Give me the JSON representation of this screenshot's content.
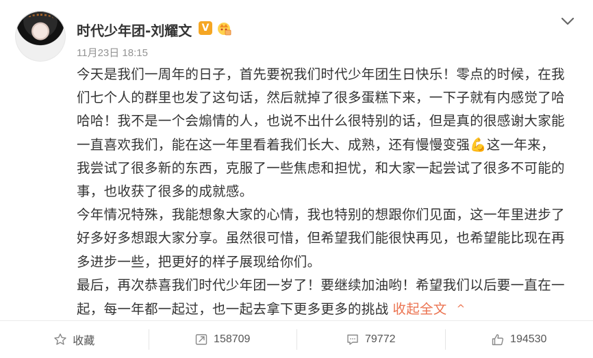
{
  "post": {
    "username": "时代少年团-刘耀文",
    "verified_badge": "V",
    "timestamp": "11月23日 18:15",
    "paragraphs": [
      "今天是我们一周年的日子，首先要祝我们时代少年团生日快乐！零点的时候，在我们七个人的群里也发了这句话，然后就掉了很多蛋糕下来，一下子就有内感觉了哈哈哈！我不是一个会煽情的人，也说不出什么很特别的话，但是真的很感谢大家能一直喜欢我们，能在这一年里看着我们长大、成熟，还有慢慢变强💪这一年来，我尝试了很多新的东西，克服了一些焦虑和担忧，和大家一起尝试了很多不可能的事，也收获了很多的成就感。",
      "今年情况特殊，我能想象大家的心情，我也特别的想跟你们见面，这一年里进步了好多好多想跟大家分享。虽然很可惜，但希望我们能很快再见，也希望能比现在再多进步一些，把更好的样子展现给你们。",
      "最后，再次恭喜我们时代少年团一岁了！要继续加油哟！希望我们以后要一直在一起，每一年都一起过，也一起去拿下更多更多的挑战"
    ],
    "collapse_label": "收起全文",
    "collapse_arrow": "^"
  },
  "actions": {
    "favorite": {
      "label": "收藏",
      "icon": "star-icon"
    },
    "repost": {
      "count": "158709",
      "icon": "repost-icon"
    },
    "comment": {
      "count": "79772",
      "icon": "comment-icon"
    },
    "like": {
      "count": "194530",
      "icon": "thumbs-up-icon"
    }
  },
  "colors": {
    "accent": "#eb7350",
    "badge": "#f5a623",
    "text": "#333333",
    "meta": "#939393"
  }
}
